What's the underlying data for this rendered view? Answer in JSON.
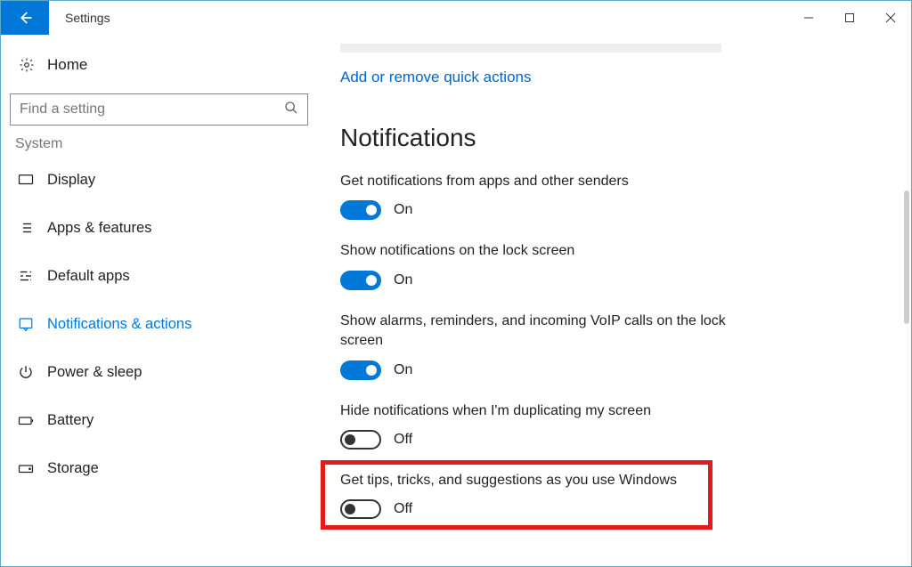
{
  "titlebar": {
    "app_title": "Settings"
  },
  "sidebar": {
    "home_label": "Home",
    "search_placeholder": "Find a setting",
    "section_label": "System",
    "items": [
      {
        "label": "Display",
        "icon": "display-icon"
      },
      {
        "label": "Apps & features",
        "icon": "list-icon"
      },
      {
        "label": "Default apps",
        "icon": "defaults-icon"
      },
      {
        "label": "Notifications & actions",
        "icon": "notifications-icon",
        "active": true
      },
      {
        "label": "Power & sleep",
        "icon": "power-icon"
      },
      {
        "label": "Battery",
        "icon": "battery-icon"
      },
      {
        "label": "Storage",
        "icon": "storage-icon"
      }
    ]
  },
  "main": {
    "quick_actions_link": "Add or remove quick actions",
    "heading": "Notifications",
    "settings": [
      {
        "desc": "Get notifications from apps and other senders",
        "state": "on",
        "state_label": "On"
      },
      {
        "desc": "Show notifications on the lock screen",
        "state": "on",
        "state_label": "On"
      },
      {
        "desc": "Show alarms, reminders, and incoming VoIP calls on the lock screen",
        "state": "on",
        "state_label": "On"
      },
      {
        "desc": "Hide notifications when I'm duplicating my screen",
        "state": "off",
        "state_label": "Off"
      },
      {
        "desc": "Get tips, tricks, and suggestions as you use Windows",
        "state": "off",
        "state_label": "Off",
        "highlighted": true
      }
    ]
  }
}
